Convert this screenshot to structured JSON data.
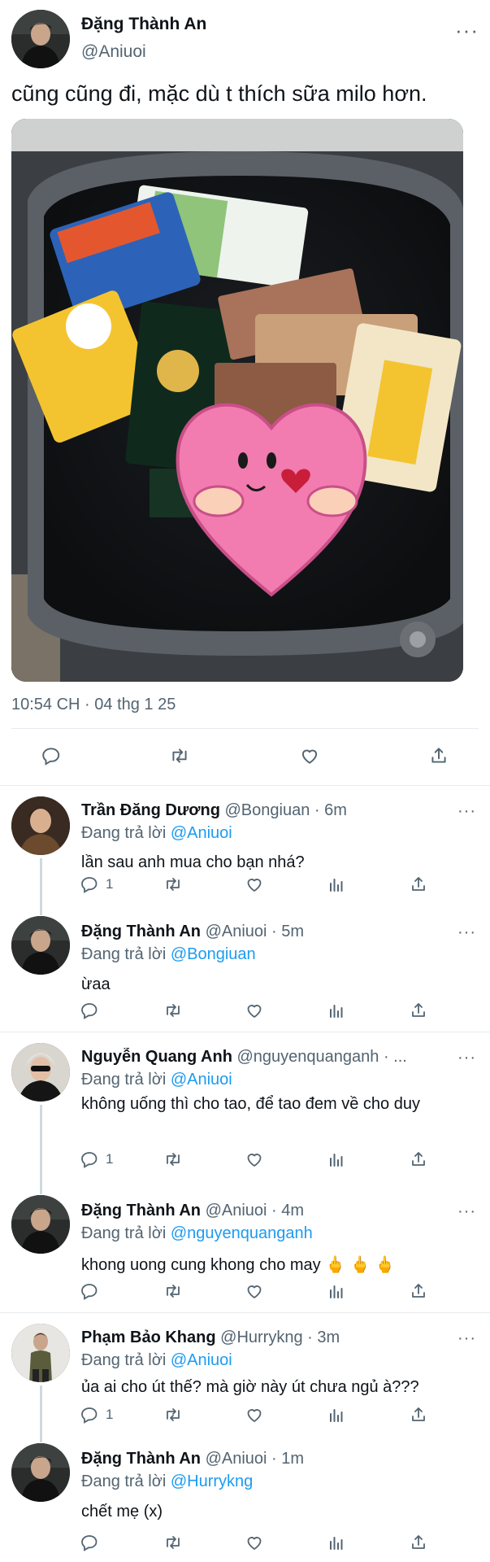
{
  "main_tweet": {
    "author_name": "Đặng Thành An",
    "author_handle": "@Aniuoi",
    "text": "cũng cũng đi, mặc dù t thích sữa milo hơn.",
    "timestamp": "10:54 CH · 04 thg 1 25",
    "more_label": "···"
  },
  "replies": [
    {
      "name": "Trần Đăng Dương",
      "meta": "@Bongiuan · 6m",
      "replying_prefix": "Đang trả lời ",
      "replying_to": "@Aniuoi",
      "text": "lần sau anh mua cho bạn nhá?",
      "reply_count": "1",
      "more_label": "···"
    },
    {
      "name": "Đặng Thành An",
      "meta": "@Aniuoi · 5m",
      "replying_prefix": "Đang trả lời ",
      "replying_to": "@Bongiuan",
      "text": "ừaa",
      "reply_count": "",
      "more_label": "···"
    },
    {
      "name": "Nguyễn Quang Anh",
      "meta": "@nguyenquanganh · ...",
      "replying_prefix": "Đang trả lời ",
      "replying_to": "@Aniuoi",
      "text": "không uống thì cho tao, để tao đem về cho duy",
      "reply_count": "1",
      "more_label": "···"
    },
    {
      "name": "Đặng Thành An",
      "meta": "@Aniuoi · 4m",
      "replying_prefix": "Đang trả lời ",
      "replying_to": "@nguyenquanganh",
      "text": "khong uong cung khong cho may 🖕 🖕 🖕",
      "reply_count": "",
      "more_label": "···"
    },
    {
      "name": "Phạm Bảo Khang",
      "meta": "@Hurrykng · 3m",
      "replying_prefix": "Đang trả lời ",
      "replying_to": "@Aniuoi",
      "text": "ủa ai cho út thế? mà giờ này út chưa ngủ à???",
      "reply_count": "1",
      "more_label": "···"
    },
    {
      "name": "Đặng Thành An",
      "meta": "@Aniuoi · 1m",
      "replying_prefix": "Đang trả lời ",
      "replying_to": "@Hurrykng",
      "text": "chết mẹ (x)",
      "reply_count": "",
      "more_label": "···"
    }
  ],
  "icons": [
    "reply-icon",
    "retweet-icon",
    "like-icon",
    "share-icon",
    "analytics-icon",
    "more-icon"
  ],
  "colors": {
    "text": "#0f1419",
    "secondary": "#536471",
    "link": "#1d9bf0",
    "divider": "#e6ecf0",
    "sticker_pink": "#f27bb0"
  }
}
